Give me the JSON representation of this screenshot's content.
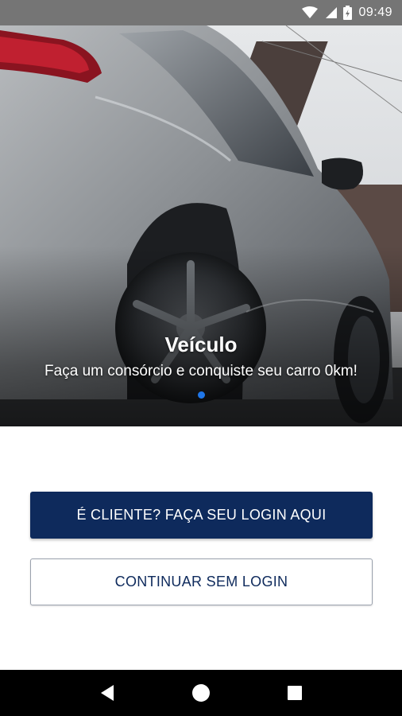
{
  "status_bar": {
    "time": "09:49",
    "icons": [
      "wifi-icon",
      "signal-icon",
      "battery-icon"
    ],
    "background": "#757575"
  },
  "carousel": {
    "slides": [
      {
        "title": "Veículo",
        "subtitle": "Faça um consórcio e conquiste seu carro 0km!",
        "image": "silver-car-photo"
      }
    ],
    "active_index": 0,
    "dot_active_color": "#1f76e8"
  },
  "actions": {
    "login_label": "É CLIENTE? FAÇA SEU LOGIN AQUI",
    "guest_label": "CONTINUAR SEM LOGIN",
    "primary_color": "#0e2a5c"
  },
  "nav_bar": {
    "buttons": [
      "back-icon",
      "home-icon",
      "recents-icon"
    ]
  }
}
